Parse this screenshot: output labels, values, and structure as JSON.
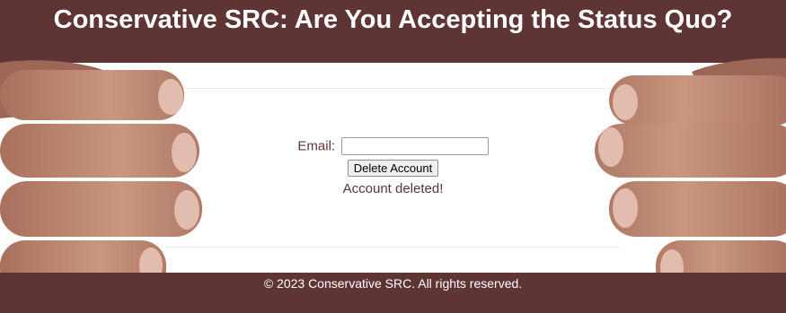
{
  "header": {
    "title": "Conservative SRC: Are You Accepting the Status Quo?"
  },
  "form": {
    "email_label": "Email:",
    "email_value": "",
    "delete_button_label": "Delete Account",
    "status_message": "Account deleted!"
  },
  "footer": {
    "text": "© 2023 Conservative SRC. All rights reserved."
  },
  "colors": {
    "brand": "#5e3434",
    "skin": "#c48f7a"
  },
  "images": {
    "left": "hands-gripping-left",
    "right": "hands-gripping-right"
  }
}
